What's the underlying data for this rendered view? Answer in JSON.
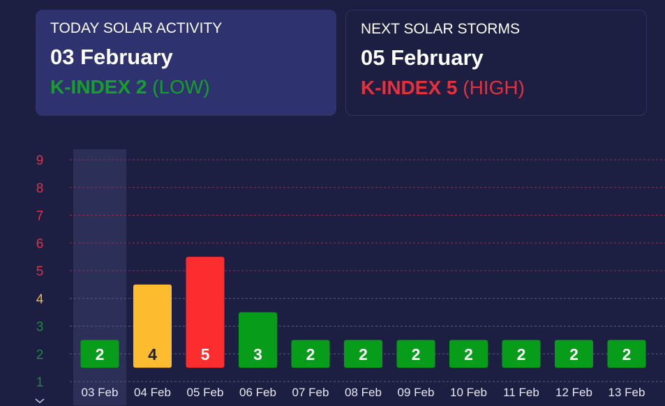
{
  "today": {
    "label": "TODAY SOLAR ACTIVITY",
    "date": "03 February",
    "kindex": "K-INDEX 2",
    "level": "(LOW)"
  },
  "next": {
    "label": "NEXT SOLAR STORMS",
    "date": "05 February",
    "kindex": "K-INDEX 5",
    "level": "(HIGH)"
  },
  "colors": {
    "low": "#079d1a",
    "moderate": "#fbbd2f",
    "high": "#fb2d2e",
    "background": "#1d1f42"
  },
  "chart_data": {
    "type": "bar",
    "categories": [
      "03 Feb",
      "04 Feb",
      "05 Feb",
      "06 Feb",
      "07 Feb",
      "08 Feb",
      "09 Feb",
      "10 Feb",
      "11 Feb",
      "12 Feb",
      "13 Feb"
    ],
    "values": [
      2,
      4,
      5,
      3,
      2,
      2,
      2,
      2,
      2,
      2,
      2
    ],
    "ylim": [
      1,
      9
    ],
    "yticks": [
      1,
      2,
      3,
      4,
      5,
      6,
      7,
      8,
      9
    ],
    "highlighted_category": "03 Feb",
    "grid": true,
    "scroll_icon": "chevron-down-icon"
  }
}
